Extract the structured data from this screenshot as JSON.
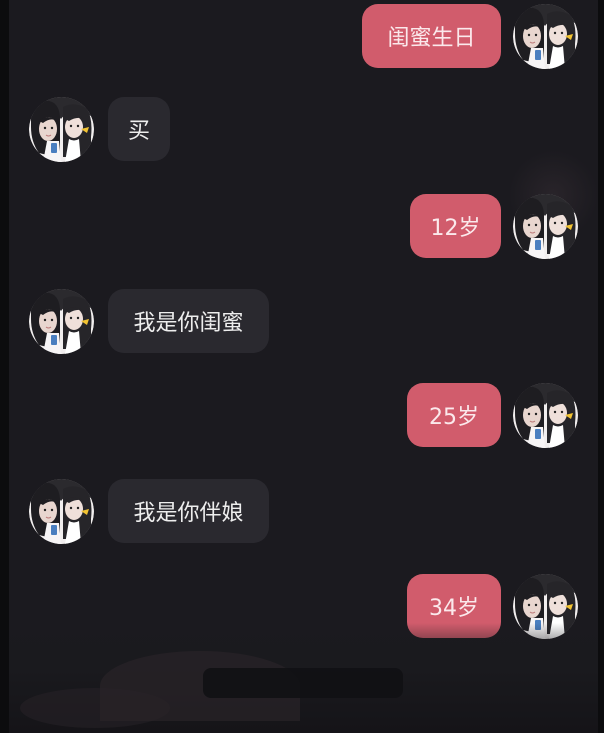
{
  "chat": {
    "theme": {
      "background": "#1b1a1f",
      "sent_bubble_color": "#d15c6c",
      "received_bubble_color": "#2a292f"
    },
    "messages": [
      {
        "side": "right",
        "text": "闺蜜生日",
        "avatar": "avatar-photo-icon"
      },
      {
        "side": "left",
        "text": "买",
        "avatar": "avatar-photo-icon"
      },
      {
        "side": "right",
        "text": "12岁",
        "avatar": "avatar-photo-icon"
      },
      {
        "side": "left",
        "text": "我是你闺蜜",
        "avatar": "avatar-photo-icon"
      },
      {
        "side": "right",
        "text": "25岁",
        "avatar": "avatar-photo-icon"
      },
      {
        "side": "left",
        "text": "我是你伴娘",
        "avatar": "avatar-photo-icon"
      },
      {
        "side": "right",
        "text": "34岁",
        "avatar": "avatar-photo-icon"
      }
    ]
  }
}
